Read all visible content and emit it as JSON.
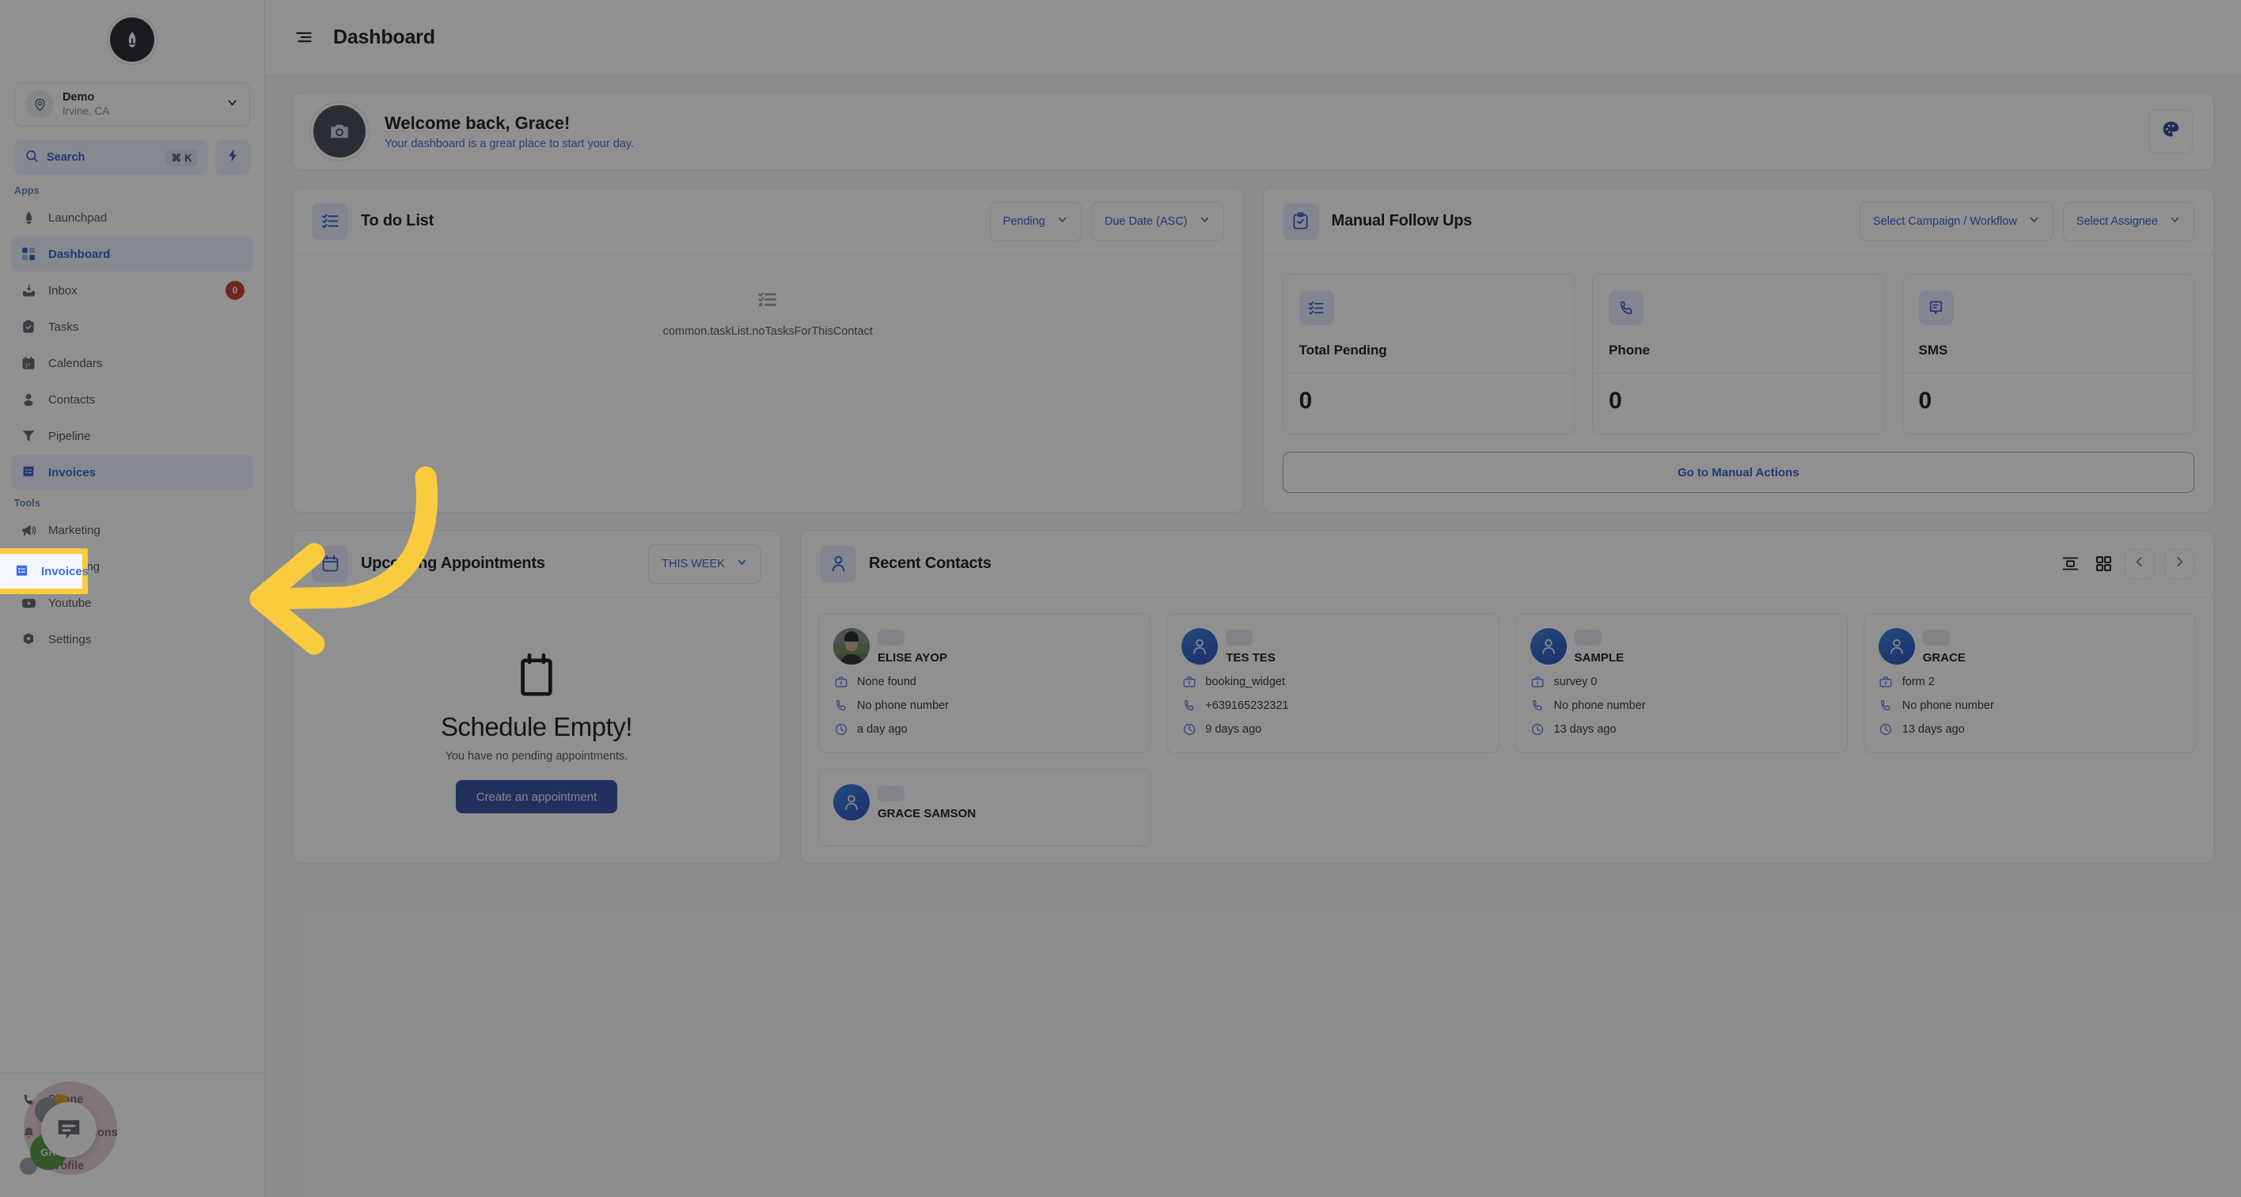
{
  "sidebar": {
    "brand_icon": "rocket-logo-icon",
    "location": {
      "name": "Demo",
      "sub": "Irvine, CA",
      "avatar_icon": "map-pin-icon",
      "chevron_icon": "chevron-down-icon"
    },
    "search": {
      "label": "Search",
      "shortcut": "⌘ K",
      "icon": "search-icon",
      "quick_action_icon": "lightning-bolt-icon"
    },
    "groups": [
      {
        "label": "Apps"
      },
      {
        "label": "Tools"
      }
    ],
    "apps": [
      {
        "label": "Launchpad",
        "icon": "rocket-icon",
        "active": false,
        "badge": ""
      },
      {
        "label": "Dashboard",
        "icon": "grid-squares-icon",
        "active": true,
        "badge": ""
      },
      {
        "label": "Inbox",
        "icon": "inbox-icon",
        "active": false,
        "badge": "0"
      },
      {
        "label": "Tasks",
        "icon": "clipboard-check-icon",
        "active": false,
        "badge": ""
      },
      {
        "label": "Calendars",
        "icon": "calendar-icon",
        "active": false,
        "badge": ""
      },
      {
        "label": "Contacts",
        "icon": "person-icon",
        "active": false,
        "badge": ""
      },
      {
        "label": "Pipeline",
        "icon": "funnel-icon",
        "active": false,
        "badge": ""
      },
      {
        "label": "Invoices",
        "icon": "invoice-icon",
        "active": true,
        "badge": ""
      }
    ],
    "tools": [
      {
        "label": "Marketing",
        "icon": "megaphone-icon"
      },
      {
        "label": "Reporting",
        "icon": "pie-chart-icon"
      },
      {
        "label": "Youtube",
        "icon": "youtube-icon"
      },
      {
        "label": "Settings",
        "icon": "gear-icon"
      }
    ],
    "bottom": [
      {
        "label": "Phone",
        "icon": "phone-icon"
      },
      {
        "label": "Notifications",
        "icon": "bell-icon"
      },
      {
        "label": "Profile",
        "icon": "avatar-icon"
      }
    ],
    "chat_widget": {
      "icon": "chat-bubble-icon",
      "initials": "GR"
    }
  },
  "topbar": {
    "menu_icon": "hamburger-menu-icon",
    "title": "Dashboard"
  },
  "welcome": {
    "avatar_icon": "camera-icon",
    "title": "Welcome back, Grace!",
    "subtitle": "Your dashboard is a great place to start your day.",
    "palette_icon": "color-palette-icon"
  },
  "todo": {
    "icon": "checklist-icon",
    "title": "To do List",
    "status_filter": "Pending",
    "sort_filter": "Due Date (ASC)",
    "chevron_icon": "chevron-down-icon",
    "empty_icon": "checklist-icon",
    "empty_text": "common.taskList.noTasksForThisContact"
  },
  "manual_follow_ups": {
    "icon": "clipboard-check-icon",
    "title": "Manual Follow Ups",
    "campaign_filter": "Select Campaign / Workflow",
    "assignee_filter": "Select Assignee",
    "chevron_icon": "chevron-down-icon",
    "stats": [
      {
        "label": "Total Pending",
        "value": "0",
        "icon": "checklist-icon"
      },
      {
        "label": "Phone",
        "value": "0",
        "icon": "phone-icon"
      },
      {
        "label": "SMS",
        "value": "0",
        "icon": "sms-bubble-icon"
      }
    ],
    "cta": "Go to Manual Actions"
  },
  "appointments": {
    "icon": "calendar-icon",
    "title": "Upcoming Appointments",
    "range_filter": "THIS WEEK",
    "chevron_icon": "chevron-down-icon",
    "empty_icon": "calendar-icon",
    "empty_title": "Schedule Empty!",
    "empty_sub": "You have no pending appointments.",
    "cta": "Create an appointment"
  },
  "recent_contacts": {
    "icon": "person-icon",
    "title": "Recent Contacts",
    "list_view_icon": "list-view-icon",
    "grid_view_icon": "grid-view-icon",
    "prev_icon": "chevron-left-icon",
    "next_icon": "chevron-right-icon",
    "field_icons": {
      "source": "briefcase-icon",
      "phone": "phone-icon",
      "time": "clock-icon"
    },
    "items": [
      {
        "name": "ELISE AYOP",
        "source": "None found",
        "phone": "No phone number",
        "time": "a day ago",
        "avatar_type": "photo"
      },
      {
        "name": "TES TES",
        "source": "booking_widget",
        "phone": "+639165232321",
        "time": "9 days ago",
        "avatar_type": "initialsless"
      },
      {
        "name": "SAMPLE",
        "source": "survey 0",
        "phone": "No phone number",
        "time": "13 days ago",
        "avatar_type": "initialsless"
      },
      {
        "name": "GRACE",
        "source": "form 2",
        "phone": "No phone number",
        "time": "13 days ago",
        "avatar_type": "initialsless"
      }
    ],
    "next_row": [
      {
        "name": "GRACE SAMSON",
        "avatar_type": "initialsless"
      }
    ]
  },
  "annotation": {
    "highlight_target": "Invoices",
    "highlight_color": "#fbcb3f",
    "arrow_color": "#fbcb3f",
    "arrow_icon": "curved-left-arrow-icon"
  }
}
